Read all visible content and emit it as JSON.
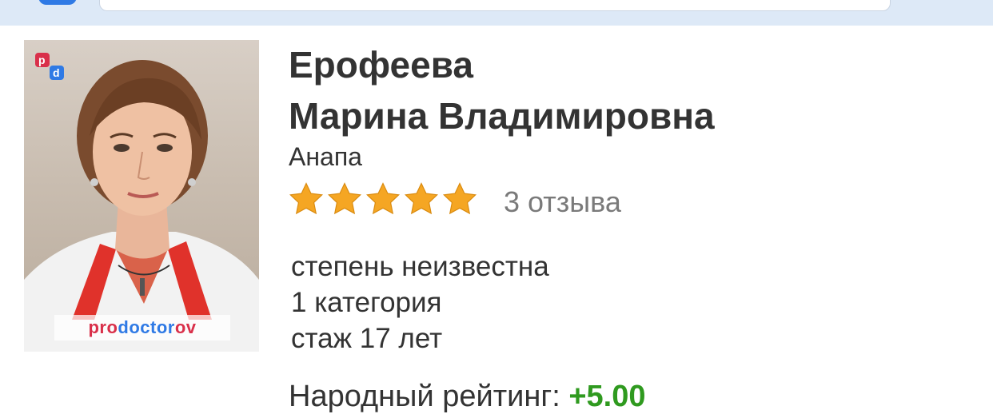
{
  "doctor": {
    "surname": "Ерофеева",
    "given_names": "Марина Владимировна",
    "city": "Анапа",
    "rating_stars": 5,
    "reviews": "3 отзыва",
    "degree": "степень неизвестна",
    "category": "1 категория",
    "experience": "стаж 17 лет",
    "people_rating_label": "Народный рейтинг:",
    "people_rating_value": "+5.00"
  },
  "photo_watermark": {
    "pro": "pro",
    "doctor": "doctor",
    "ov": "ov"
  },
  "colors": {
    "star": "#f5a623",
    "rating_positive": "#2f9a1f",
    "topbar": "#dde9f7"
  }
}
